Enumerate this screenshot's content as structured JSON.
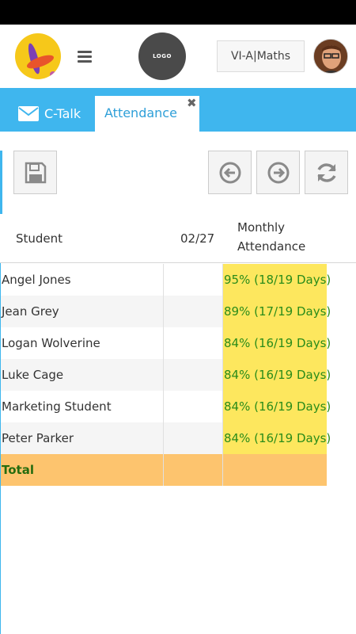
{
  "header": {
    "app_logo_icon": "feather-app-logo",
    "menu_icon": "hamburger-icon",
    "school_logo_text": "LOGO",
    "class_selector": "VI-A|Maths"
  },
  "tabs": [
    {
      "label": "C-Talk",
      "icon": "mail-icon"
    },
    {
      "label": "Attendance",
      "close": "✖"
    }
  ],
  "toolbar": {
    "save_icon": "save-icon",
    "prev_icon": "arrow-left-circle-icon",
    "next_icon": "arrow-right-circle-icon",
    "refresh_icon": "refresh-icon"
  },
  "table": {
    "columns": [
      "Student",
      "02/27",
      "Monthly Attendance"
    ],
    "rows": [
      {
        "name": "Angel Jones",
        "date": "",
        "monthly": "95% (18/19 Days)"
      },
      {
        "name": "Jean Grey",
        "date": "",
        "monthly": "89% (17/19 Days)"
      },
      {
        "name": "Logan Wolverine",
        "date": "",
        "monthly": "84% (16/19 Days)"
      },
      {
        "name": "Luke Cage",
        "date": "",
        "monthly": "84% (16/19 Days)"
      },
      {
        "name": "Marketing Student",
        "date": "",
        "monthly": "84% (16/19 Days)"
      },
      {
        "name": "Peter Parker",
        "date": "",
        "monthly": "84% (16/19 Days)"
      }
    ],
    "total_label": "Total"
  },
  "colors": {
    "accent": "#3fb6ee",
    "attendance_highlight": "#fde75e",
    "total_row": "#fdc46e",
    "attendance_text": "#2a8c1a"
  }
}
